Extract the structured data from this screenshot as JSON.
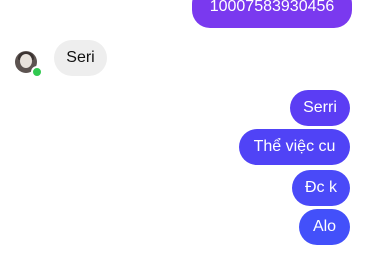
{
  "conversation": {
    "top_outgoing": "10007583930456",
    "incoming": [
      {
        "text": "Seri"
      }
    ],
    "outgoing": [
      {
        "text": "Serri"
      },
      {
        "text": "Thể việc cu"
      },
      {
        "text": "Đc k"
      },
      {
        "text": "Alo"
      }
    ],
    "contact": {
      "online": true,
      "avatar_icon": "user-avatar-icon"
    }
  },
  "colors": {
    "outgoing_gradient_top": "#7a39ef",
    "outgoing_gradient_bottom": "#4350fa",
    "incoming_bubble": "#eeeeee",
    "online_indicator": "#31c950"
  }
}
